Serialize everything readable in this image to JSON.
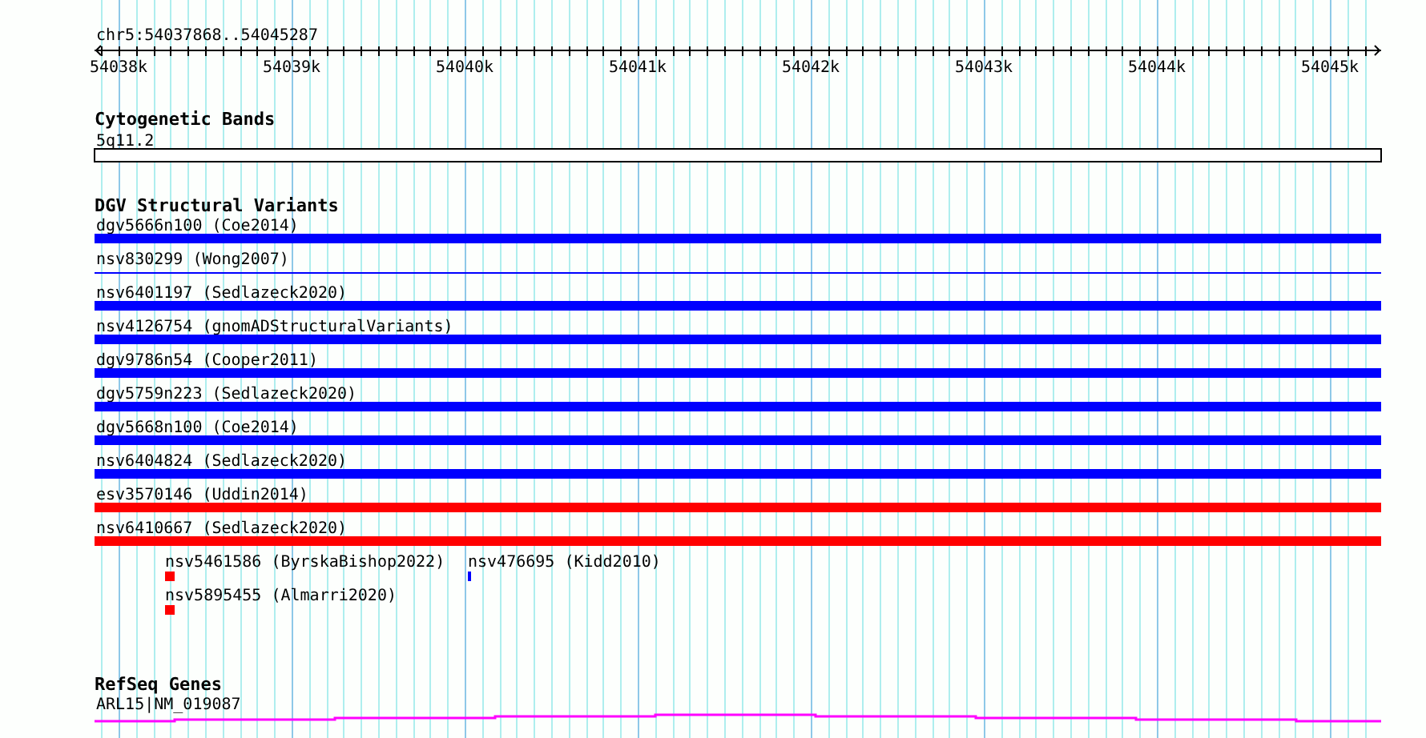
{
  "ruler": {
    "position": "chr5:54037868..54045287",
    "ticks": [
      "54038k",
      "54039k",
      "54040k",
      "54041k",
      "54042k",
      "54043k",
      "54044k",
      "54045k"
    ]
  },
  "tracks": [
    {
      "kind": "bands",
      "title": "Cytogenetic Bands",
      "band": "5q11.2"
    },
    {
      "kind": "variants",
      "title": "DGV Structural Variants",
      "rows": [
        [
          {
            "label": "dgv5666n100 (Coe2014)",
            "kind": "bar",
            "color": "#0000ff"
          }
        ],
        [
          {
            "label": "nsv830299 (Wong2007)",
            "kind": "line",
            "color": "#0000ff"
          }
        ],
        [
          {
            "label": "nsv6401197 (Sedlazeck2020)",
            "kind": "bar",
            "color": "#0000ff"
          }
        ],
        [
          {
            "label": "nsv4126754 (gnomADStructuralVariants)",
            "kind": "bar",
            "color": "#0000ff"
          }
        ],
        [
          {
            "label": "dgv9786n54 (Cooper2011)",
            "kind": "bar",
            "color": "#0000ff"
          }
        ],
        [
          {
            "label": "dgv5759n223 (Sedlazeck2020)",
            "kind": "bar",
            "color": "#0000ff"
          }
        ],
        [
          {
            "label": "dgv5668n100 (Coe2014)",
            "kind": "bar",
            "color": "#0000ff"
          }
        ],
        [
          {
            "label": "nsv6404824 (Sedlazeck2020)",
            "kind": "bar",
            "color": "#0000ff"
          }
        ],
        [
          {
            "label": "esv3570146 (Uddin2014)",
            "kind": "bar",
            "color": "#ff0000"
          }
        ],
        [
          {
            "label": "nsv6410667 (Sedlazeck2020)",
            "kind": "bar",
            "color": "#ff0000"
          }
        ],
        [
          {
            "label": "nsv5461586 (ByrskaBishop2022)",
            "kind": "point",
            "color": "#ff0000"
          },
          {
            "label": "nsv476695 (Kidd2010)",
            "kind": "tick",
            "color": "#0000ff"
          }
        ],
        [
          {
            "label": "nsv5895455 (Almarri2020)",
            "kind": "point",
            "color": "#ff0000"
          }
        ]
      ]
    },
    {
      "kind": "genes",
      "title": "RefSeq Genes",
      "gene": "ARL15|NM_019087"
    }
  ]
}
